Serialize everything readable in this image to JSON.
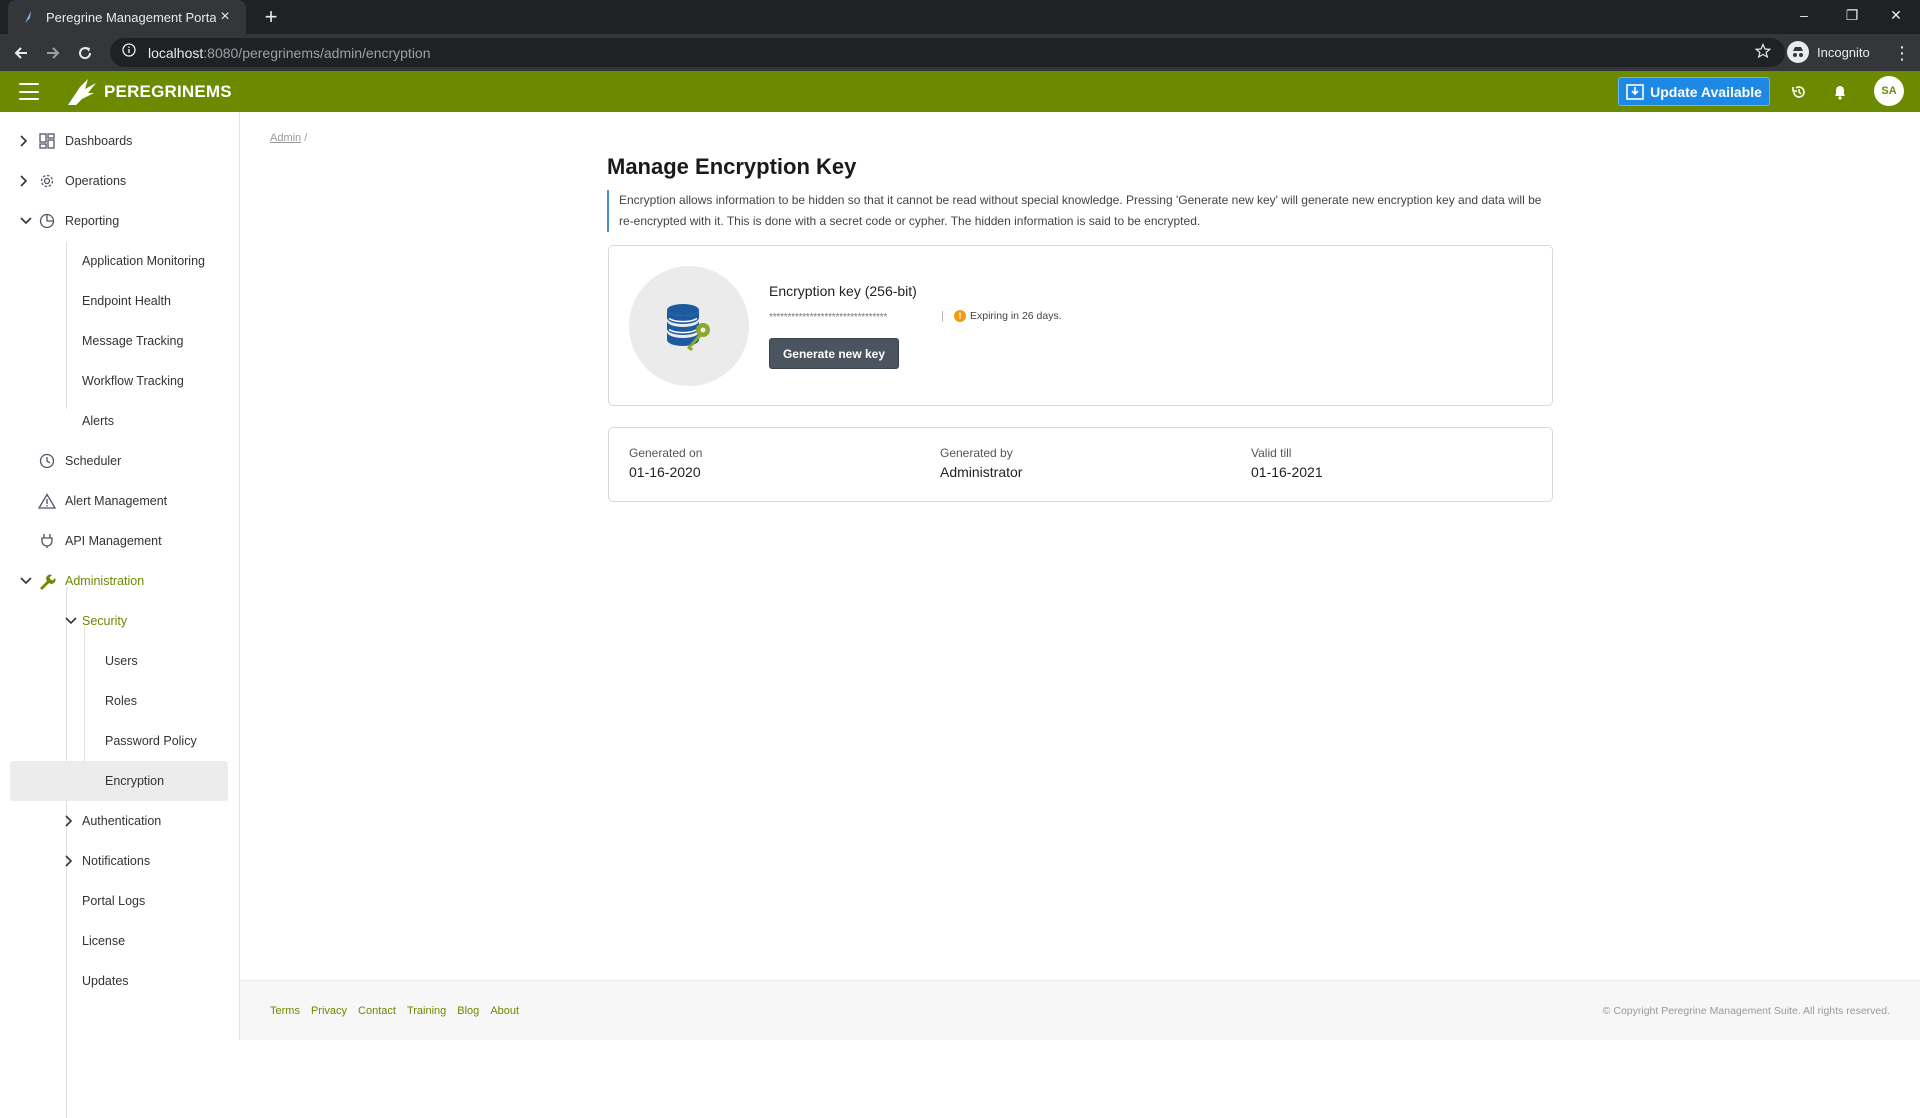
{
  "browser": {
    "tab_title": "Peregrine Management Portal",
    "tab_close": "×",
    "new_tab": "+",
    "url_host": "localhost",
    "url_rest": ":8080/peregrinems/admin/encryption",
    "profile_label": "Incognito",
    "window_controls": [
      "–",
      "❐",
      "✕"
    ]
  },
  "header": {
    "logo_text": "PEREGRINEMS",
    "update_label": "Update Available",
    "avatar_initials": "SA",
    "icons": [
      "history-icon",
      "bell-icon"
    ]
  },
  "sidebar": {
    "items": [
      {
        "label": "Dashboards",
        "icon": "dashboard-icon"
      },
      {
        "label": "Operations",
        "icon": "gear-icon"
      },
      {
        "label": "Reporting",
        "icon": "pie-chart-icon"
      },
      {
        "label": "Application Monitoring"
      },
      {
        "label": "Endpoint Health"
      },
      {
        "label": "Message Tracking"
      },
      {
        "label": "Workflow Tracking"
      },
      {
        "label": "Alerts"
      },
      {
        "label": "Scheduler",
        "icon": "clock-icon"
      },
      {
        "label": "Alert Management",
        "icon": "warning-icon"
      },
      {
        "label": "API Management",
        "icon": "plug-icon"
      },
      {
        "label": "Administration",
        "icon": "wrench-icon"
      },
      {
        "label": "Security"
      },
      {
        "label": "Users"
      },
      {
        "label": "Roles"
      },
      {
        "label": "Password Policy"
      },
      {
        "label": "Encryption"
      },
      {
        "label": "Authentication"
      },
      {
        "label": "Notifications"
      },
      {
        "label": "Portal Logs"
      },
      {
        "label": "License"
      },
      {
        "label": "Updates"
      }
    ]
  },
  "main": {
    "breadcrumb_link": "Admin",
    "breadcrumb_sep": "/",
    "title": "Manage Encryption Key",
    "description": "Encryption allows information to be hidden so that it cannot be read without special knowledge. Pressing 'Generate new key' will generate new encryption key and data will be re-encrypted with it. This is done with a secret code or cypher. The hidden information is said to be encrypted.",
    "key": {
      "title": "Encryption key (256-bit)",
      "masked": "********************************",
      "separator": "|",
      "expiry_text": "Expiring in 26 days.",
      "button_label": "Generate new key"
    },
    "meta": {
      "generated_on_label": "Generated on",
      "generated_on_value": "01-16-2020",
      "generated_by_label": "Generated by",
      "generated_by_value": "Administrator",
      "valid_till_label": "Valid till",
      "valid_till_value": "01-16-2021"
    }
  },
  "footer": {
    "links": [
      "Terms",
      "Privacy",
      "Contact",
      "Training",
      "Blog",
      "About"
    ],
    "copyright": "© Copyright Peregrine Management Suite. All rights reserved."
  },
  "colors": {
    "brand_green": "#6b8a00",
    "update_blue": "#1e88e5",
    "warning_orange": "#f39c12",
    "button_dark": "#4a5560"
  }
}
